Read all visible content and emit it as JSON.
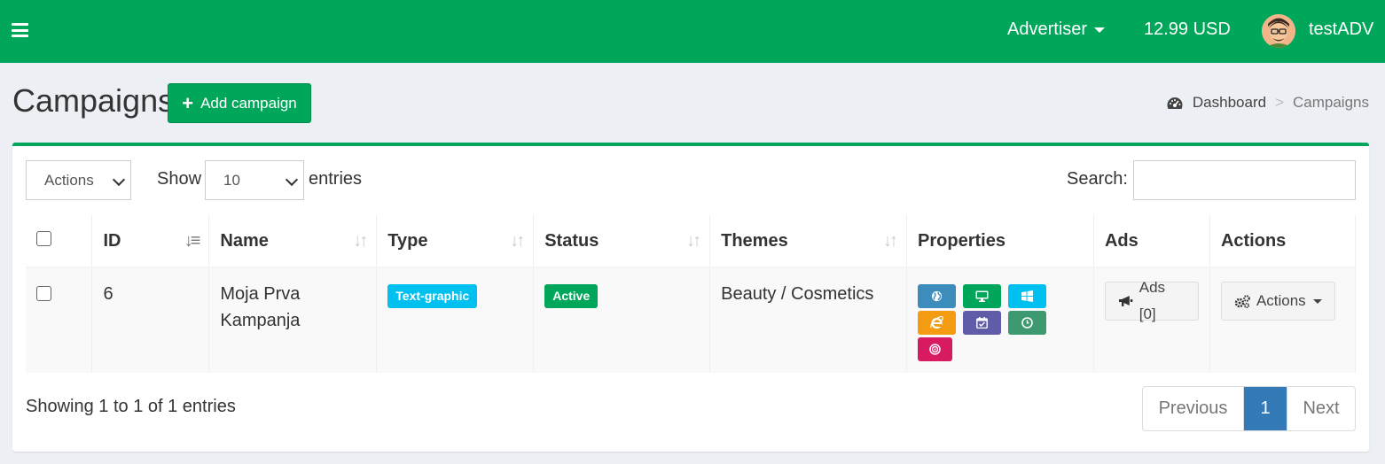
{
  "topbar": {
    "role": "Advertiser",
    "balance": "12.99 USD",
    "username": "testADV",
    "bg_color": "#00a65a"
  },
  "header": {
    "title": "Campaigns",
    "add_button": "Add campaign",
    "breadcrumb": {
      "home": "Dashboard",
      "separator": ">",
      "current": "Campaigns"
    }
  },
  "toolbar": {
    "bulk_action": "Actions",
    "show_label": "Show",
    "page_size": "10",
    "entries_label": "entries",
    "search_label": "Search:",
    "search_value": ""
  },
  "table": {
    "columns": [
      "ID",
      "Name",
      "Type",
      "Status",
      "Themes",
      "Properties",
      "Ads",
      "Actions"
    ],
    "rows": [
      {
        "id": "6",
        "name_line1": "Moja Prva",
        "name_line2": "Kampanja",
        "type": "Text-graphic",
        "status": "Active",
        "themes": "Beauty / Cosmetics",
        "properties": [
          {
            "icon": "globe-icon",
            "color": "#3c8dbc"
          },
          {
            "icon": "desktop-icon",
            "color": "#00a65a"
          },
          {
            "icon": "windows-icon",
            "color": "#00c0ef"
          },
          {
            "icon": "internet-explorer-icon",
            "color": "#f39c12"
          },
          {
            "icon": "calendar-check-icon",
            "color": "#605ca8"
          },
          {
            "icon": "clock-icon",
            "color": "#3d9970"
          },
          {
            "icon": "target-icon",
            "color": "#d81b60"
          }
        ],
        "ads_button": "Ads [0]",
        "actions_button": "Actions"
      }
    ]
  },
  "footer": {
    "info": "Showing 1 to 1 of 1 entries",
    "pagination": {
      "previous": "Previous",
      "current_page": "1",
      "next": "Next"
    }
  },
  "colors": {
    "label_type": "#00c0ef",
    "label_status": "#00a65a",
    "pagination_active": "#337ab7"
  }
}
